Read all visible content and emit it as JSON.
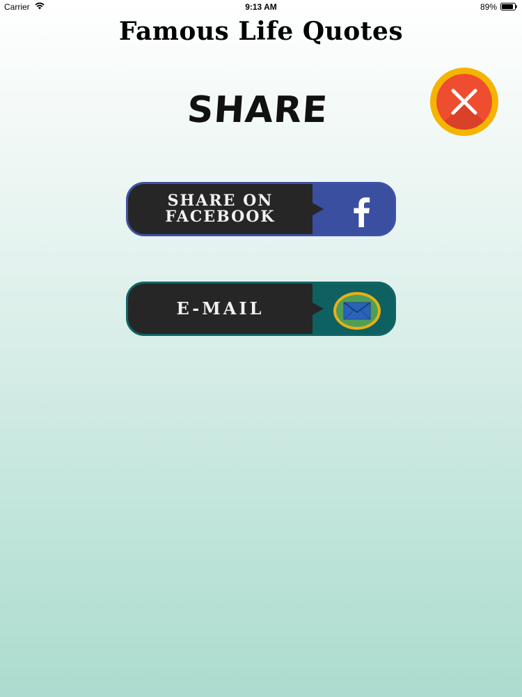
{
  "status_bar": {
    "carrier": "Carrier",
    "time": "9:13 AM",
    "battery": "89%",
    "battery_level": 0.89
  },
  "app": {
    "title": "Famous Life Quotes"
  },
  "share_panel": {
    "heading": "SHARE",
    "facebook_label": "SHARE ON\nFACEBOOK",
    "email_label": "E-MAIL"
  },
  "icons": {
    "wifi": "wifi-icon",
    "battery": "battery-icon",
    "close": "close-icon",
    "facebook": "facebook-icon",
    "mail": "mail-icon"
  },
  "colors": {
    "facebook_blue": "#3b4fa0",
    "email_teal": "#0f6161",
    "close_red": "#ef4d2f",
    "close_ring": "#f4b400",
    "label_dark": "#262626"
  }
}
